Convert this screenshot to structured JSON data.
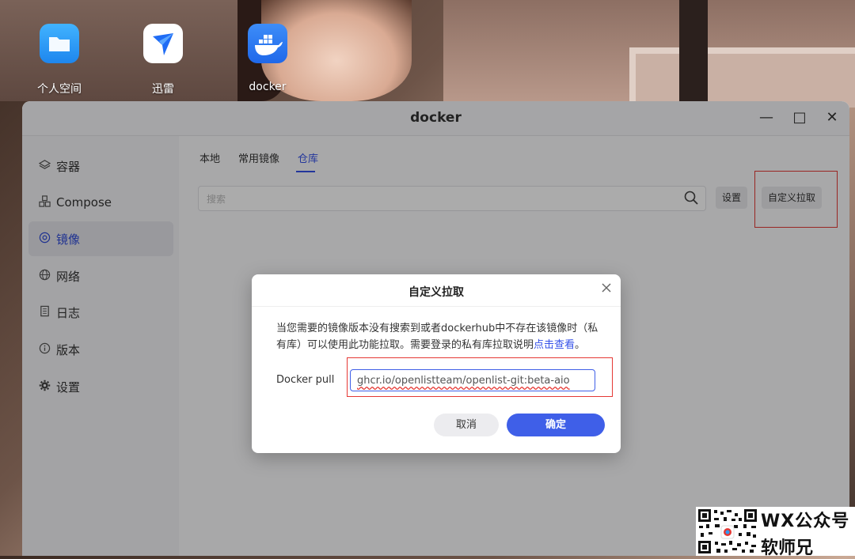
{
  "desktop": {
    "icons": [
      {
        "label": "个人空间",
        "icon": "folder-icon",
        "color": "#2f9bf5"
      },
      {
        "label": "迅雷",
        "icon": "thunder-bird-icon",
        "color": "#1f6cf5"
      },
      {
        "label": "docker",
        "icon": "docker-whale-icon",
        "color": "#2e7cf6"
      }
    ]
  },
  "window": {
    "title": "docker",
    "controls": {
      "minimize": "—",
      "maximize": "□",
      "close": "✕"
    }
  },
  "sidebar": {
    "items": [
      {
        "label": "容器",
        "icon": "layers-icon"
      },
      {
        "label": "Compose",
        "icon": "cubes-icon"
      },
      {
        "label": "镜像",
        "icon": "disc-icon",
        "active": true
      },
      {
        "label": "网络",
        "icon": "globe-icon"
      },
      {
        "label": "日志",
        "icon": "document-icon"
      },
      {
        "label": "版本",
        "icon": "info-icon"
      },
      {
        "label": "设置",
        "icon": "gear-icon"
      }
    ]
  },
  "main": {
    "tabs": [
      {
        "label": "本地"
      },
      {
        "label": "常用镜像"
      },
      {
        "label": "仓库",
        "active": true
      }
    ],
    "search_placeholder": "搜索",
    "settings_button": "设置",
    "custom_pull_button": "自定义拉取"
  },
  "dialog": {
    "title": "自定义拉取",
    "description": "当您需要的镜像版本没有搜索到或者dockerhub中不存在该镜像时（私有库）可以使用此功能拉取。需要登录的私有库拉取说明",
    "link_text": "点击查看",
    "description_end": "。",
    "pull_label": "Docker pull",
    "pull_value": "ghcr.io/openlistteam/openlist-git:beta-aio",
    "cancel_button": "取消",
    "confirm_button": "确定"
  },
  "watermark": {
    "line1": "WX公众号",
    "line2": "软师兄"
  },
  "colors": {
    "accent": "#3f5fe8",
    "highlight_box": "#e53935"
  }
}
